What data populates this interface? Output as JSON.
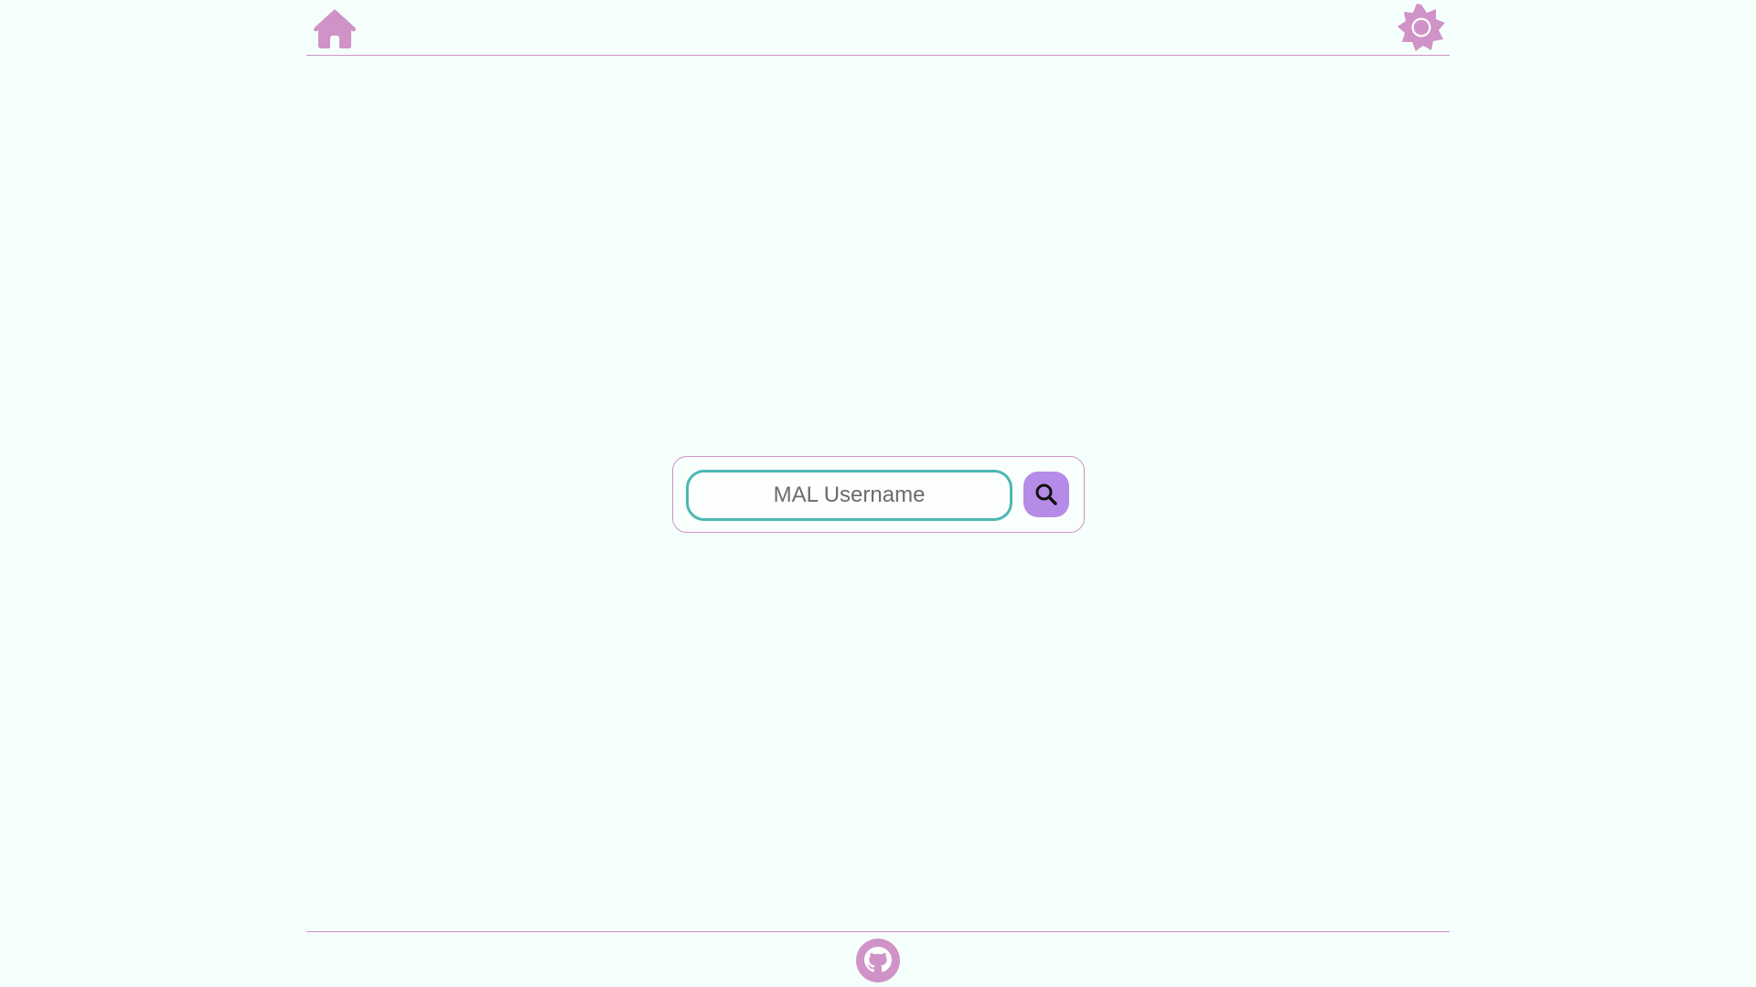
{
  "header": {
    "home_icon": "home-icon",
    "theme_icon": "sun-icon"
  },
  "search": {
    "placeholder": "MAL Username",
    "value": "",
    "button_icon": "search-icon"
  },
  "footer": {
    "github_icon": "github-icon"
  },
  "colors": {
    "background": "#f5fffb",
    "accent_pink": "#cf93c7",
    "input_border": "#4bb8b3",
    "search_button": "#b58be8"
  }
}
